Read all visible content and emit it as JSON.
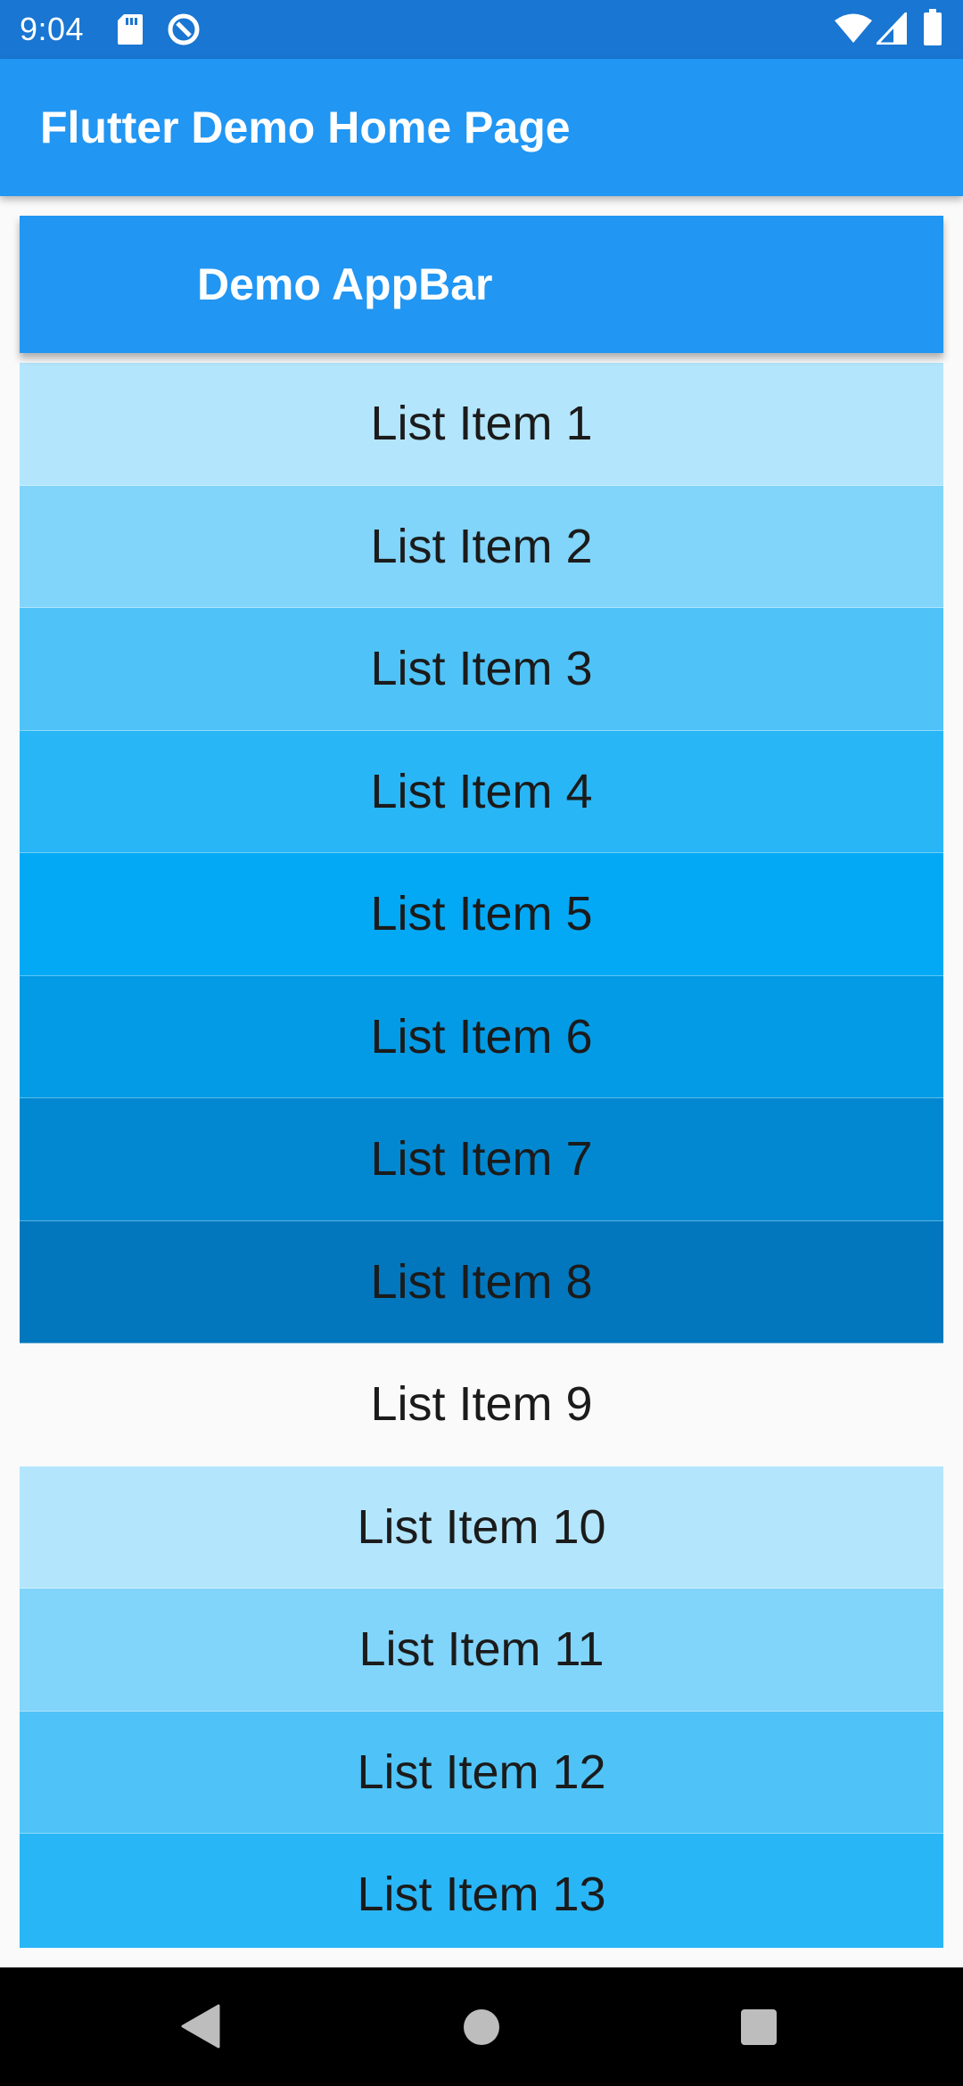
{
  "status_bar": {
    "time": "9:04",
    "icons": [
      "sd-card-icon",
      "data-saver-icon",
      "wifi-icon",
      "cell-signal-icon",
      "battery-icon"
    ]
  },
  "app_bar": {
    "title": "Flutter Demo Home Page",
    "color": "#2196f3"
  },
  "demo_app_bar": {
    "title": "Demo AppBar",
    "color": "#2196f3"
  },
  "list": {
    "items": [
      {
        "label": "List Item 1",
        "color": "#b3e5fc"
      },
      {
        "label": "List Item 2",
        "color": "#81d4fa"
      },
      {
        "label": "List Item 3",
        "color": "#4fc3f7"
      },
      {
        "label": "List Item 4",
        "color": "#29b6f6"
      },
      {
        "label": "List Item 5",
        "color": "#03a9f4"
      },
      {
        "label": "List Item 6",
        "color": "#039be5"
      },
      {
        "label": "List Item 7",
        "color": "#0288d1"
      },
      {
        "label": "List Item 8",
        "color": "#0277bd"
      },
      {
        "label": "List Item 9",
        "color": "#fafafa"
      },
      {
        "label": "List Item 10",
        "color": "#b3e5fc"
      },
      {
        "label": "List Item 11",
        "color": "#81d4fa"
      },
      {
        "label": "List Item 12",
        "color": "#4fc3f7"
      },
      {
        "label": "List Item 13",
        "color": "#29b6f6"
      }
    ]
  },
  "nav_bar": {
    "buttons": [
      "back-icon",
      "home-icon",
      "recents-icon"
    ]
  }
}
